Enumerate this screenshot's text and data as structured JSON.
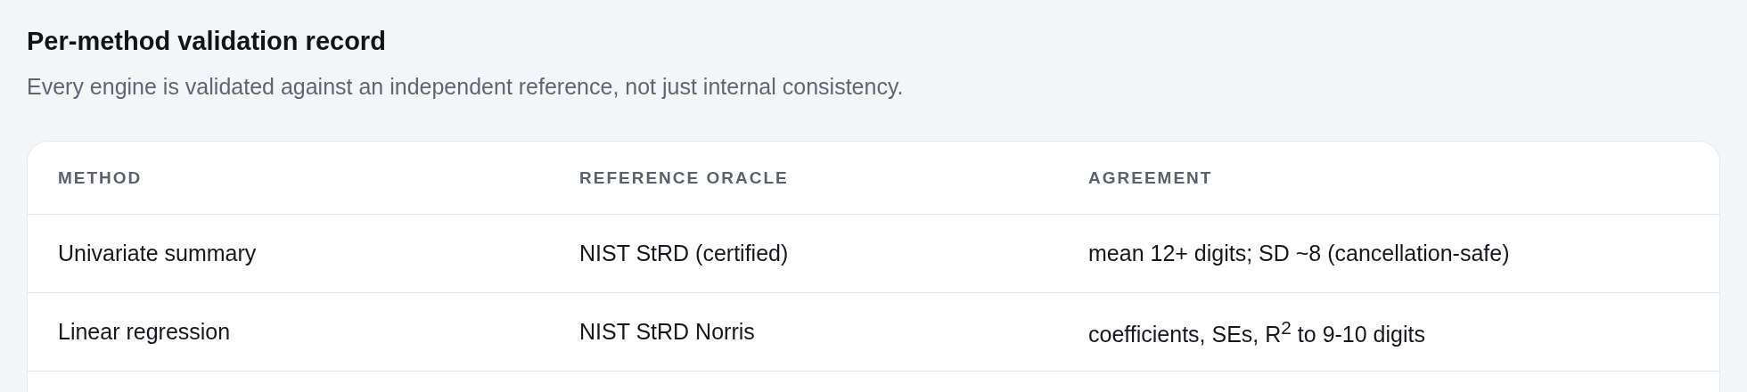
{
  "title": "Per-method validation record",
  "subtitle": "Every engine is validated against an independent reference, not just internal consistency.",
  "table": {
    "columns": [
      "METHOD",
      "REFERENCE ORACLE",
      "AGREEMENT"
    ],
    "rows": [
      [
        "Univariate summary",
        "NIST StRD (certified)",
        "mean 12+ digits; SD ~8 (cancellation-safe)"
      ],
      [
        "Linear regression",
        "NIST StRD Norris",
        "coefficients, SEs, R$^{2}$ to 9-10 digits"
      ]
    ]
  }
}
